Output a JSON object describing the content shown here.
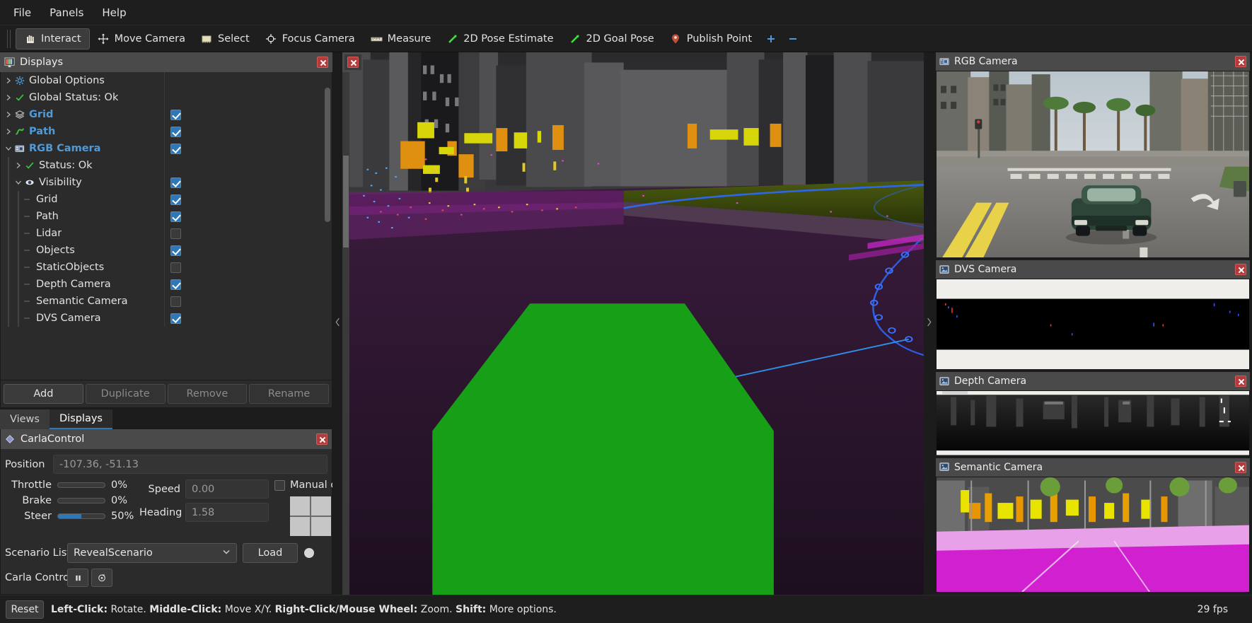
{
  "menu": {
    "items": [
      "File",
      "Panels",
      "Help"
    ]
  },
  "toolbar": {
    "items": [
      {
        "label": "Interact",
        "icon": "hand-icon",
        "active": true
      },
      {
        "label": "Move Camera",
        "icon": "move-camera-icon",
        "active": false
      },
      {
        "label": "Select",
        "icon": "select-icon",
        "active": false
      },
      {
        "label": "Focus Camera",
        "icon": "focus-camera-icon",
        "active": false
      },
      {
        "label": "Measure",
        "icon": "ruler-icon",
        "active": false
      },
      {
        "label": "2D Pose Estimate",
        "icon": "pose-arrow-icon",
        "active": false
      },
      {
        "label": "2D Goal Pose",
        "icon": "goal-arrow-icon",
        "active": false
      },
      {
        "label": "Publish Point",
        "icon": "map-pin-icon",
        "active": false
      },
      {
        "label": "+",
        "icon": "plus-icon",
        "active": false
      },
      {
        "label": "−",
        "icon": "minus-icon",
        "active": false
      }
    ]
  },
  "displays_panel": {
    "title": "Displays",
    "icon": "displays-icon",
    "tree": [
      {
        "label": "Global Options",
        "indent": 0,
        "arrow": "right",
        "icon": "gear-icon",
        "style": "plain",
        "check": null
      },
      {
        "label": "Global Status: Ok",
        "indent": 0,
        "arrow": "right",
        "icon": "check-icon",
        "style": "plain",
        "check": null
      },
      {
        "label": "Grid",
        "indent": 0,
        "arrow": "right",
        "icon": "grid-icon",
        "style": "blue",
        "check": "on"
      },
      {
        "label": "Path",
        "indent": 0,
        "arrow": "right",
        "icon": "path-icon",
        "style": "blue",
        "check": "on"
      },
      {
        "label": "RGB Camera",
        "indent": 0,
        "arrow": "down",
        "icon": "camera-icon",
        "style": "blue",
        "check": "on"
      },
      {
        "label": "Status: Ok",
        "indent": 1,
        "arrow": "right",
        "icon": "check-icon",
        "style": "plain",
        "check": null
      },
      {
        "label": "Visibility",
        "indent": 1,
        "arrow": "down",
        "icon": "eye-icon",
        "style": "plain",
        "check": "on"
      },
      {
        "label": "Grid",
        "indent": 2,
        "arrow": "leaf",
        "icon": "none",
        "style": "plain",
        "check": "on"
      },
      {
        "label": "Path",
        "indent": 2,
        "arrow": "leaf",
        "icon": "none",
        "style": "plain",
        "check": "on"
      },
      {
        "label": "Lidar",
        "indent": 2,
        "arrow": "leaf",
        "icon": "none",
        "style": "plain",
        "check": "off"
      },
      {
        "label": "Objects",
        "indent": 2,
        "arrow": "leaf",
        "icon": "none",
        "style": "plain",
        "check": "on"
      },
      {
        "label": "StaticObjects",
        "indent": 2,
        "arrow": "leaf",
        "icon": "none",
        "style": "plain",
        "check": "off"
      },
      {
        "label": "Depth Camera",
        "indent": 2,
        "arrow": "leaf",
        "icon": "none",
        "style": "plain",
        "check": "on"
      },
      {
        "label": "Semantic Camera",
        "indent": 2,
        "arrow": "leaf",
        "icon": "none",
        "style": "plain",
        "check": "off"
      },
      {
        "label": "DVS Camera",
        "indent": 2,
        "arrow": "leaf",
        "icon": "none",
        "style": "plain",
        "check": "on"
      }
    ],
    "buttons": [
      {
        "label": "Add",
        "enabled": true
      },
      {
        "label": "Duplicate",
        "enabled": false
      },
      {
        "label": "Remove",
        "enabled": false
      },
      {
        "label": "Rename",
        "enabled": false
      }
    ],
    "tabs": [
      {
        "label": "Views",
        "selected": false
      },
      {
        "label": "Displays",
        "selected": true
      }
    ]
  },
  "carla_panel": {
    "title": "CarlaControl",
    "icon": "carla-diamond-icon",
    "position_label": "Position",
    "position_value": "-107.36, -51.13",
    "throttle_label": "Throttle",
    "throttle_value": "0%",
    "throttle_pct": 0,
    "brake_label": "Brake",
    "brake_value": "0%",
    "brake_pct": 0,
    "steer_label": "Steer",
    "steer_value": "50%",
    "steer_pct": 50,
    "speed_label": "Speed",
    "speed_value": "0.00",
    "heading_label": "Heading",
    "heading_value": "1.58",
    "manual_control_label": "Manual control",
    "manual_control_checked": false,
    "scenario_label": "Scenario List",
    "scenario_value": "RevealScenario",
    "load_label": "Load",
    "carla_control_label": "Carla Control",
    "pause_icon": "pause-icon",
    "step_icon": "step-icon"
  },
  "viewport": {
    "close_icon": "close-icon",
    "collapse_left_icon": "chevron-left-icon",
    "collapse_right_icon": "chevron-right-icon"
  },
  "right_dock": {
    "panels": [
      {
        "title": "RGB Camera",
        "icon": "camera-icon",
        "kind": "rgb"
      },
      {
        "title": "DVS Camera",
        "icon": "image-icon",
        "kind": "dvs"
      },
      {
        "title": "Depth Camera",
        "icon": "image-icon",
        "kind": "depth"
      },
      {
        "title": "Semantic Camera",
        "icon": "image-icon",
        "kind": "semantic"
      }
    ]
  },
  "statusbar": {
    "reset_label": "Reset",
    "hint_parts": [
      {
        "text": "Left-Click:",
        "bold": true
      },
      {
        "text": " Rotate. ",
        "bold": false
      },
      {
        "text": "Middle-Click:",
        "bold": true
      },
      {
        "text": " Move X/Y. ",
        "bold": false
      },
      {
        "text": "Right-Click/Mouse Wheel:",
        "bold": true
      },
      {
        "text": " Zoom. ",
        "bold": false
      },
      {
        "text": "Shift:",
        "bold": true
      },
      {
        "text": " More options.",
        "bold": false
      }
    ],
    "fps": "29 fps"
  },
  "colors": {
    "accent": "#2f77b5",
    "tree_blue": "#4f9bd9",
    "close_red": "#b33b3b",
    "panel_header": "#4a4a4a",
    "background": "#1c1c1c"
  }
}
